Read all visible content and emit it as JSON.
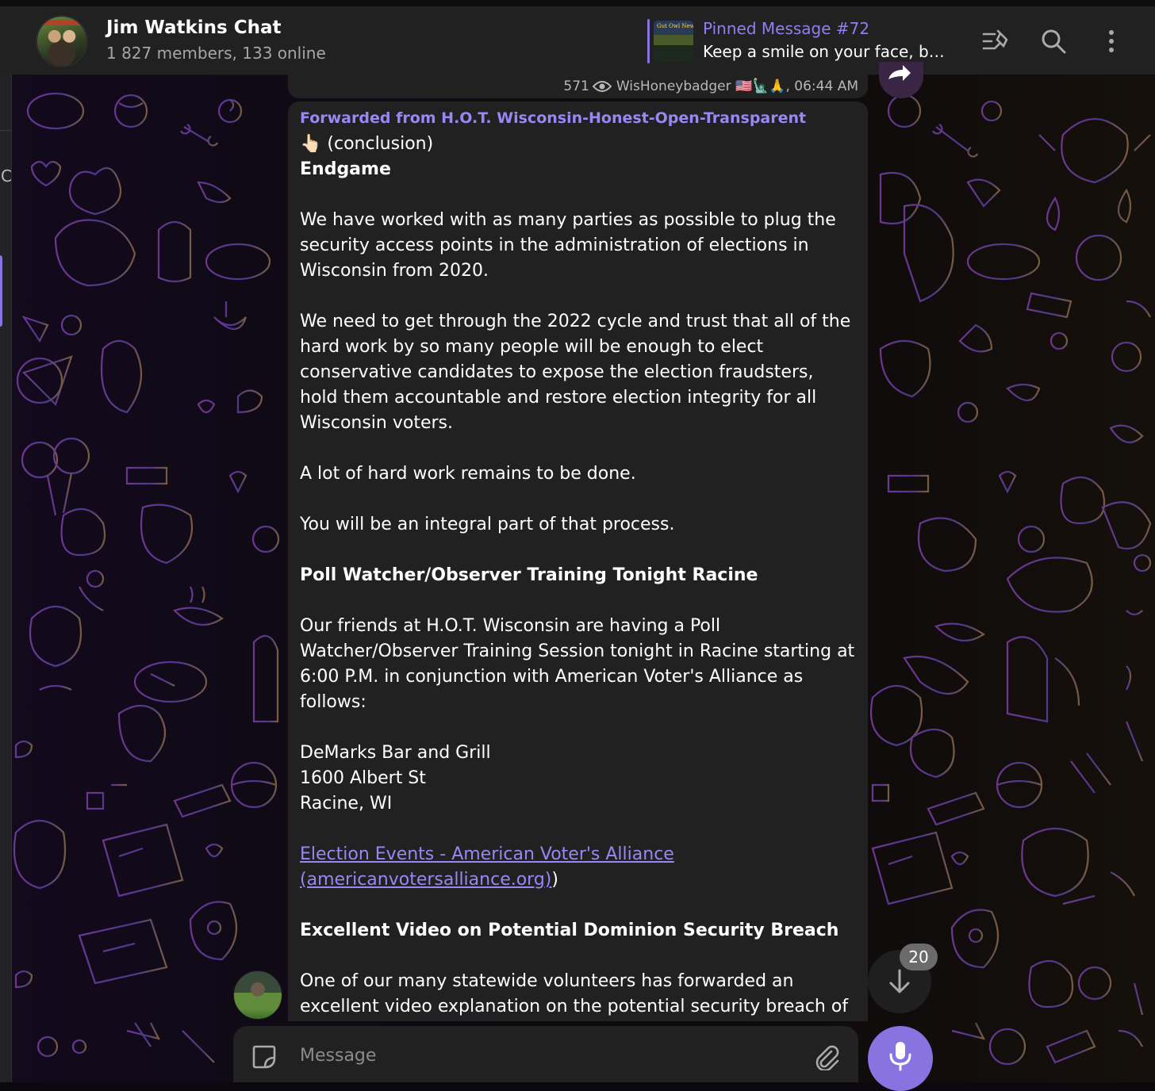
{
  "chat": {
    "title": "Jim Watkins Chat",
    "subtitle": "1 827 members, 133 online"
  },
  "pinned": {
    "title": "Pinned Message #72",
    "text": "Keep a smile on your face, but …",
    "thumb_caption": "Gut Owl News"
  },
  "header_icons": [
    "pinned-list-icon",
    "search-icon",
    "more-vertical-icon"
  ],
  "sidebar": {
    "letter": "C"
  },
  "previous_message": {
    "views": "571",
    "author": "WisHoneybadger 🇺🇸🗽🙏,",
    "time": "06:44 AM"
  },
  "message": {
    "forwarded_from": "Forwarded from H.O.T. Wisconsin-Honest-Open-Transparent",
    "lines": {
      "intro": "👆🏻 (conclusion)",
      "heading_endgame": "Endgame",
      "p1": "We have worked with as many parties as possible to plug the security access points in the administration of elections in Wisconsin from 2020.",
      "p2": "We need to get through the 2022 cycle and trust that all of the hard work by so many people will be enough to elect conservative candidates to expose the election fraudsters, hold them accountable and restore election integrity for all Wisconsin voters.",
      "p3": "A lot of hard work remains to be done.",
      "p4": "You will be an integral part of that process.",
      "heading_poll": "Poll Watcher/Observer Training Tonight Racine",
      "p5": "Our friends at H.O.T. Wisconsin are having a Poll Watcher/Observer Training Session tonight in Racine starting at 6:00 P.M. in conjunction with American Voter's Alliance as follows:",
      "addr1": "DeMarks Bar and Grill",
      "addr2": "1600 Albert St",
      "addr3": "Racine, WI",
      "link_text": "Election Events - American Voter's Alliance (americanvotersalliance.org)",
      "link_suffix": ")",
      "heading_video": "Excellent Video on Potential Dominion Security Breach",
      "p6": "One of our many statewide volunteers has forwarded an excellent video explanation on the potential security breach of"
    }
  },
  "scroll_down": {
    "unread_count": "20"
  },
  "composer": {
    "placeholder": "Message"
  },
  "colors": {
    "accent": "#8774e1",
    "link": "#9a86f4",
    "bubble": "#212121",
    "header": "#212121"
  }
}
